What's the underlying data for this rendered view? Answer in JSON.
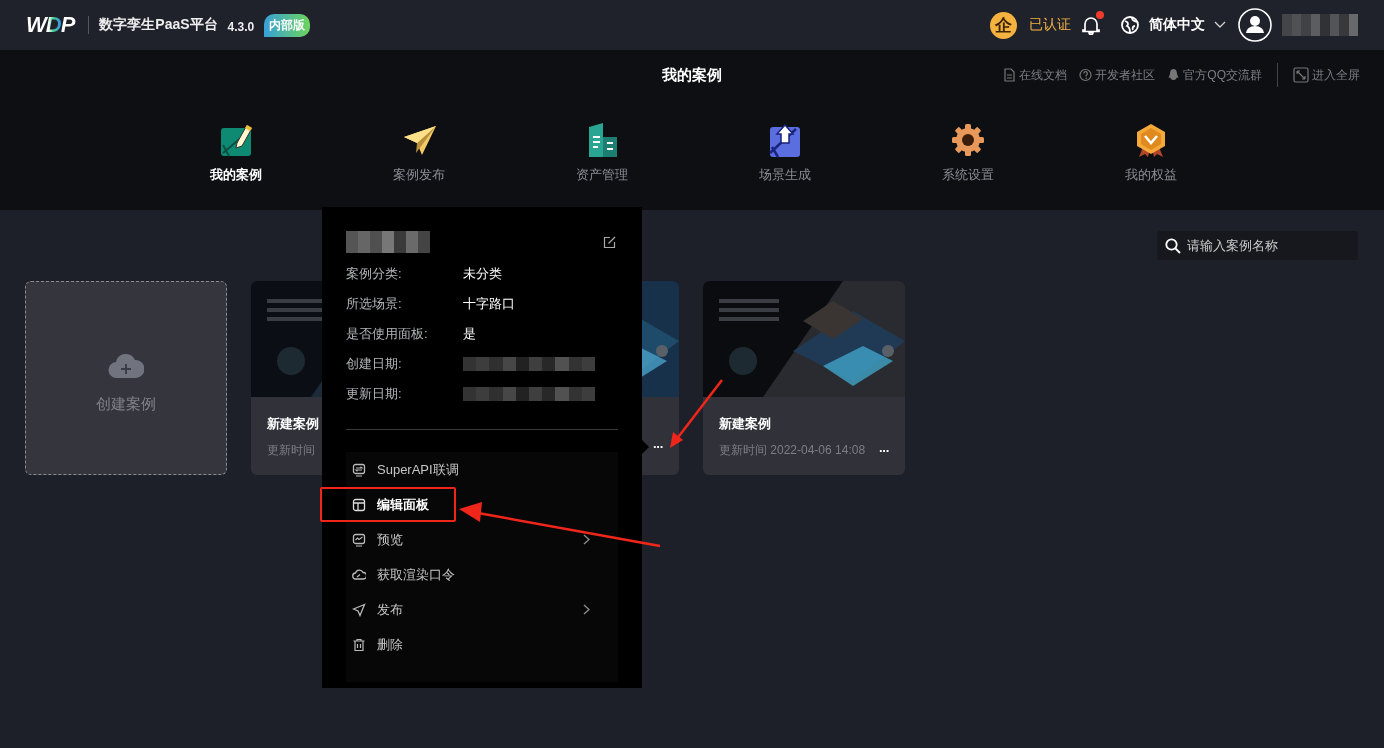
{
  "header": {
    "logo": "WDP",
    "product": "数字孪生PaaS平台",
    "version": "4.3.0",
    "badge": "内部版",
    "cert_mark": "企",
    "cert_label": "已认证",
    "notifications_unread": true,
    "language": "简体中文",
    "user_redacted": true
  },
  "subheader": {
    "title": "我的案例",
    "links": [
      {
        "label": "在线文档",
        "kind": "doc"
      },
      {
        "label": "开发者社区",
        "kind": "help"
      },
      {
        "label": "官方QQ交流群",
        "kind": "qq"
      }
    ],
    "fullscreen": "进入全屏"
  },
  "nav_tabs": [
    {
      "label": "我的案例",
      "selected": true
    },
    {
      "label": "案例发布",
      "selected": false
    },
    {
      "label": "资产管理",
      "selected": false
    },
    {
      "label": "场景生成",
      "selected": false
    },
    {
      "label": "系统设置",
      "selected": false
    },
    {
      "label": "我的权益",
      "selected": false
    }
  ],
  "search": {
    "placeholder": "请输入案例名称"
  },
  "create_card": {
    "label": "创建案例"
  },
  "cases": [
    {
      "title": "新建案例",
      "updated": "更新时间",
      "kind": "picture"
    },
    {
      "more": "···",
      "kind": "picture"
    },
    {
      "title": "新建案例",
      "updated": "更新时间 2022-04-06 14:08",
      "more": "···",
      "kind": "picture"
    }
  ],
  "popup": {
    "title_redacted": true,
    "fields": [
      {
        "label": "案例分类:",
        "value": "未分类",
        "kind": "text"
      },
      {
        "label": "所选场景:",
        "value": "十字路口",
        "kind": "text"
      },
      {
        "label": "是否使用面板:",
        "value": "是",
        "kind": "text"
      },
      {
        "label": "创建日期:",
        "kind": "redacted"
      },
      {
        "label": "更新日期:",
        "kind": "redacted"
      }
    ],
    "menu": [
      {
        "label": "SuperAPI联调",
        "kind": "api",
        "has_submenu": false,
        "highlighted": false
      },
      {
        "label": "编辑面板",
        "kind": "panel",
        "has_submenu": false,
        "highlighted": true
      },
      {
        "label": "预览",
        "kind": "preview",
        "has_submenu": true,
        "highlighted": false
      },
      {
        "label": "获取渲染口令",
        "kind": "cloud",
        "has_submenu": false,
        "highlighted": false
      },
      {
        "label": "发布",
        "kind": "send",
        "has_submenu": true,
        "highlighted": false
      },
      {
        "label": "删除",
        "kind": "trash",
        "has_submenu": false,
        "highlighted": false
      }
    ]
  }
}
